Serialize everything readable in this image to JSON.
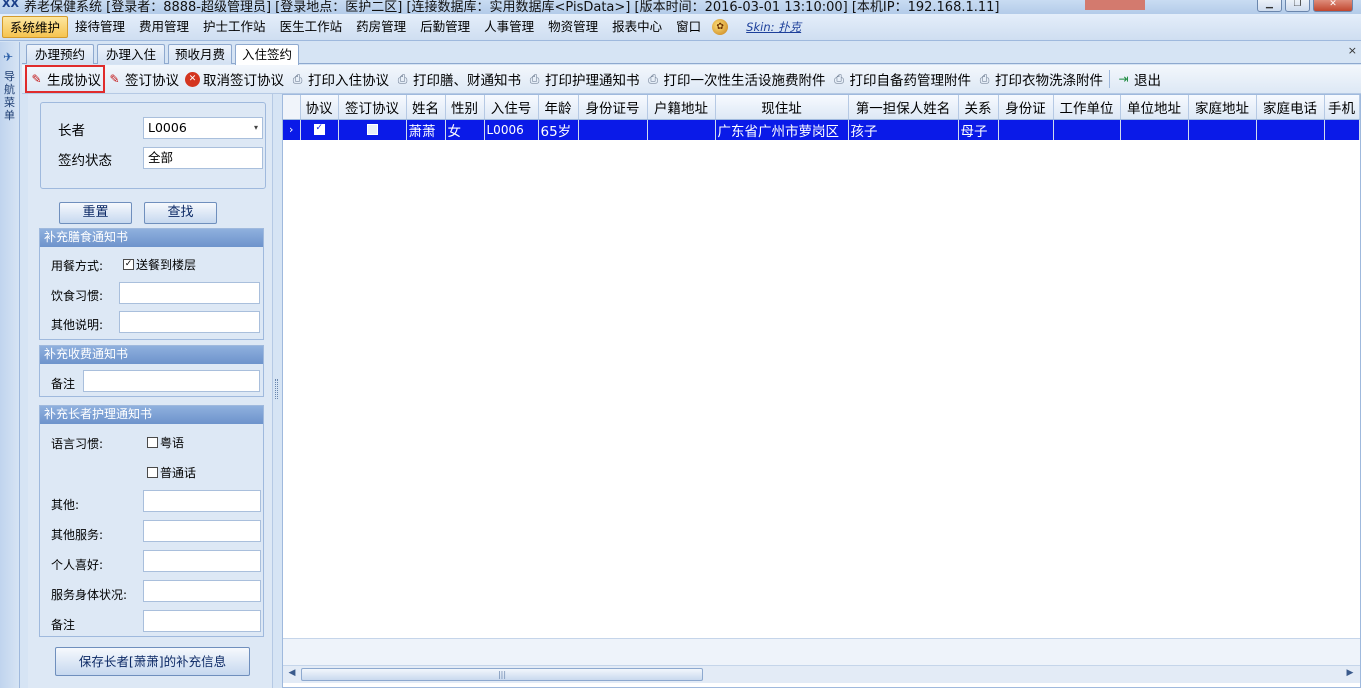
{
  "window": {
    "title": "养老保健系统   [登录者：8888-超级管理员] [登录地点：医护二区] [连接数据库：实用数据库<PisData>] [版本时间：2016-03-01 13:10:00]         [本机IP：192.168.1.11]"
  },
  "menu": {
    "items": [
      "系统维护",
      "接待管理",
      "费用管理",
      "护士工作站",
      "医生工作站",
      "药房管理",
      "后勤管理",
      "人事管理",
      "物资管理",
      "报表中心",
      "窗口"
    ],
    "skin_label": "Skin: 扑克"
  },
  "dock": {
    "label": "导航菜单"
  },
  "tabs": [
    "办理预约",
    "办理入住",
    "预收月费",
    "入住签约"
  ],
  "toolbar": {
    "generate": "生成协议",
    "sign": "签订协议",
    "cancel_sign": "取消签订协议",
    "print_admission": "打印入住协议",
    "print_meal_fee": "打印膳、财通知书",
    "print_care": "打印护理通知书",
    "print_facility": "打印一次性生活设施费附件",
    "print_medicine": "打印自备药管理附件",
    "print_laundry": "打印衣物洗涤附件",
    "exit": "退出"
  },
  "query": {
    "elder_label": "长者",
    "elder_value": "L0006",
    "status_label": "签约状态",
    "status_value": "全部",
    "reset_button": "重置",
    "search_button": "查找"
  },
  "meal_group": {
    "title": "补充膳食通知书",
    "dining_label": "用餐方式:",
    "dining_option": "送餐到楼层",
    "diet_label": "饮食习惯:",
    "other_label": "其他说明:"
  },
  "fee_group": {
    "title": "补充收费通知书",
    "remark_label": "备注"
  },
  "care_group": {
    "title": "补充长者护理通知书",
    "language_label": "语言习惯:",
    "lang_cantonese": "粤语",
    "lang_mandarin": "普通话",
    "other_label": "其他:",
    "other_service_label": "其他服务:",
    "hobby_label": "个人喜好:",
    "health_label": "服务身体状况:",
    "remark_label": "备注"
  },
  "save_button": "保存长者[萧萧]的补充信息",
  "grid": {
    "columns": [
      "协议",
      "签订协议",
      "姓名",
      "性别",
      "入住号",
      "年龄",
      "身份证号",
      "户籍地址",
      "现住址",
      "第一担保人姓名",
      "关系",
      "身份证",
      "工作单位",
      "单位地址",
      "家庭地址",
      "家庭电话",
      "手机"
    ],
    "rows": [
      {
        "name": "萧萧",
        "gender": "女",
        "admission_no": "L0006",
        "age": "65岁",
        "id_no": "",
        "household_addr": "",
        "current_addr": "广东省广州市萝岗区",
        "guarantor": "孩子",
        "relation": "母子",
        "guarantor_id": "",
        "work_unit": "",
        "unit_addr": "",
        "home_addr": "",
        "home_phone": "",
        "mobile": ""
      }
    ]
  }
}
